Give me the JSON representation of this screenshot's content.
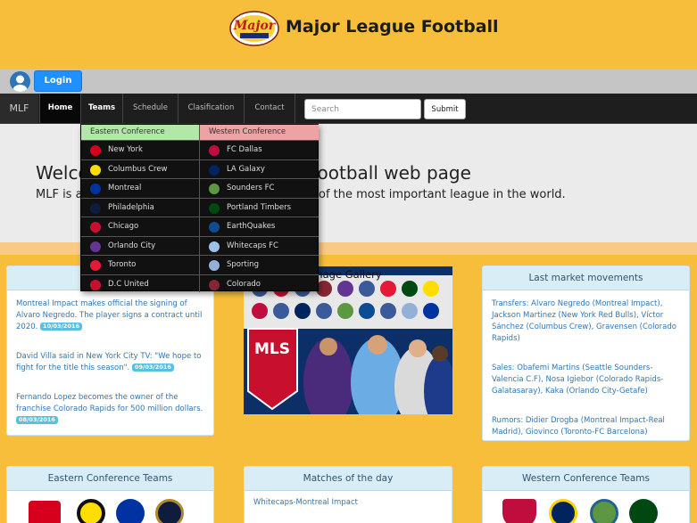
{
  "header": {
    "title": "Major League Football",
    "logo_text": "Major"
  },
  "login": {
    "label": "Login"
  },
  "nav": {
    "brand": "MLF",
    "items": [
      "Home",
      "Teams",
      "Schedule",
      "Clasification",
      "Contact"
    ],
    "search_placeholder": "Search",
    "submit_label": "Submit"
  },
  "hero": {
    "title": "Welcome to the Major League Football web page",
    "text": "MLF is an official football league considered one of the most important league in the world."
  },
  "dropdown": {
    "east_header": "Eastern Conference",
    "west_header": "Western Conference",
    "east": [
      "New York",
      "Columbus Crew",
      "Montreal",
      "Philadelphia",
      "Chicago",
      "Orlando City",
      "Toronto",
      "D.C United"
    ],
    "west": [
      "FC Dallas",
      "LA Galaxy",
      "Sounders FC",
      "Portland Timbers",
      "EarthQuakes",
      "Whitecaps FC",
      "Sporting",
      "Colorado"
    ],
    "east_colors": [
      "#d6001c",
      "#fedd00",
      "#0033a1",
      "#0e1c3d",
      "#c8102e",
      "#633492",
      "#e31937",
      "#c8102e"
    ],
    "west_colors": [
      "#bf0d3e",
      "#00245d",
      "#5d9741",
      "#004812",
      "#0d4c92",
      "#9dc2ea",
      "#93b1d7",
      "#862633"
    ]
  },
  "news": {
    "items": [
      {
        "text": "Montreal Impact makes official the signing of Alvaro Negredo. The player signs a contract until 2020.",
        "date": "10/03/2016"
      },
      {
        "text": "David Villa said in New York City TV: \"We hope to fight for the title this season\".",
        "date": "09/03/2016"
      },
      {
        "text": "Fernando Lopez becomes the owner of the franchise Colorado Rapids for 500 million dollars.",
        "date": "08/03/2016"
      }
    ]
  },
  "gallery": {
    "title": "Image Gallery",
    "image_text": "MLS"
  },
  "market": {
    "title": "Last market movements",
    "items": [
      "Transfers: Alvaro Negredo (Montreal Impact), Jackson Martinez (New York Red Bulls), Víctor Sánchez (Columbus Crew), Gravensen (Colorado Rapids)",
      "Sales: Obafemi Martins (Seattle Sounders-Valencia C.F), Nosa Igiebor (Colorado Rapids-Galatasaray), Kaka (Orlando City-Getafe)",
      "Rumors: Didier Drogba (Montreal Impact-Real Madrid), Giovinco (Toronto-FC Barcelona)"
    ]
  },
  "bottom": {
    "east_title": "Eastern Conference Teams",
    "matches_title": "Matches of the day",
    "match": "Whitecaps-Montreal Impact",
    "west_title": "Western Conference Teams"
  },
  "colors": {
    "background": "#f7be3b",
    "navbar": "#1e1e1e",
    "panel_head": "#d9edf7",
    "link": "#3276b1",
    "login": "#1e90ff"
  }
}
